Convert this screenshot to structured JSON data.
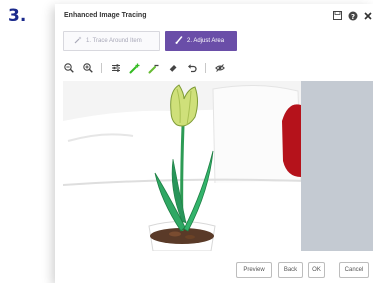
{
  "step_number": "3.",
  "dialog": {
    "title": "Enhanced Image Tracing",
    "title_icons": [
      "save-icon",
      "help-icon",
      "close-icon"
    ]
  },
  "tabs": [
    {
      "label": "1. Trace Around Item",
      "icon": "magic-wand-icon",
      "active": false
    },
    {
      "label": "2. Adjust Area",
      "icon": "brush-icon",
      "active": true
    }
  ],
  "toolbar": {
    "tools": [
      "zoom-out-icon",
      "zoom-in-icon",
      "settings-sliders-icon",
      "add-area-brush-icon",
      "remove-area-brush-icon",
      "eraser-icon",
      "undo-icon",
      "hide-icon"
    ]
  },
  "footer": {
    "preview_label": "Preview",
    "back_label": "Back",
    "ok_label": "OK",
    "cancel_label": "Cancel"
  },
  "colors": {
    "step_number": "#1b2a8c",
    "active_tab": "#6a4ea8",
    "add_tool": "#33bb22",
    "remove_tool": "#66bb33"
  }
}
